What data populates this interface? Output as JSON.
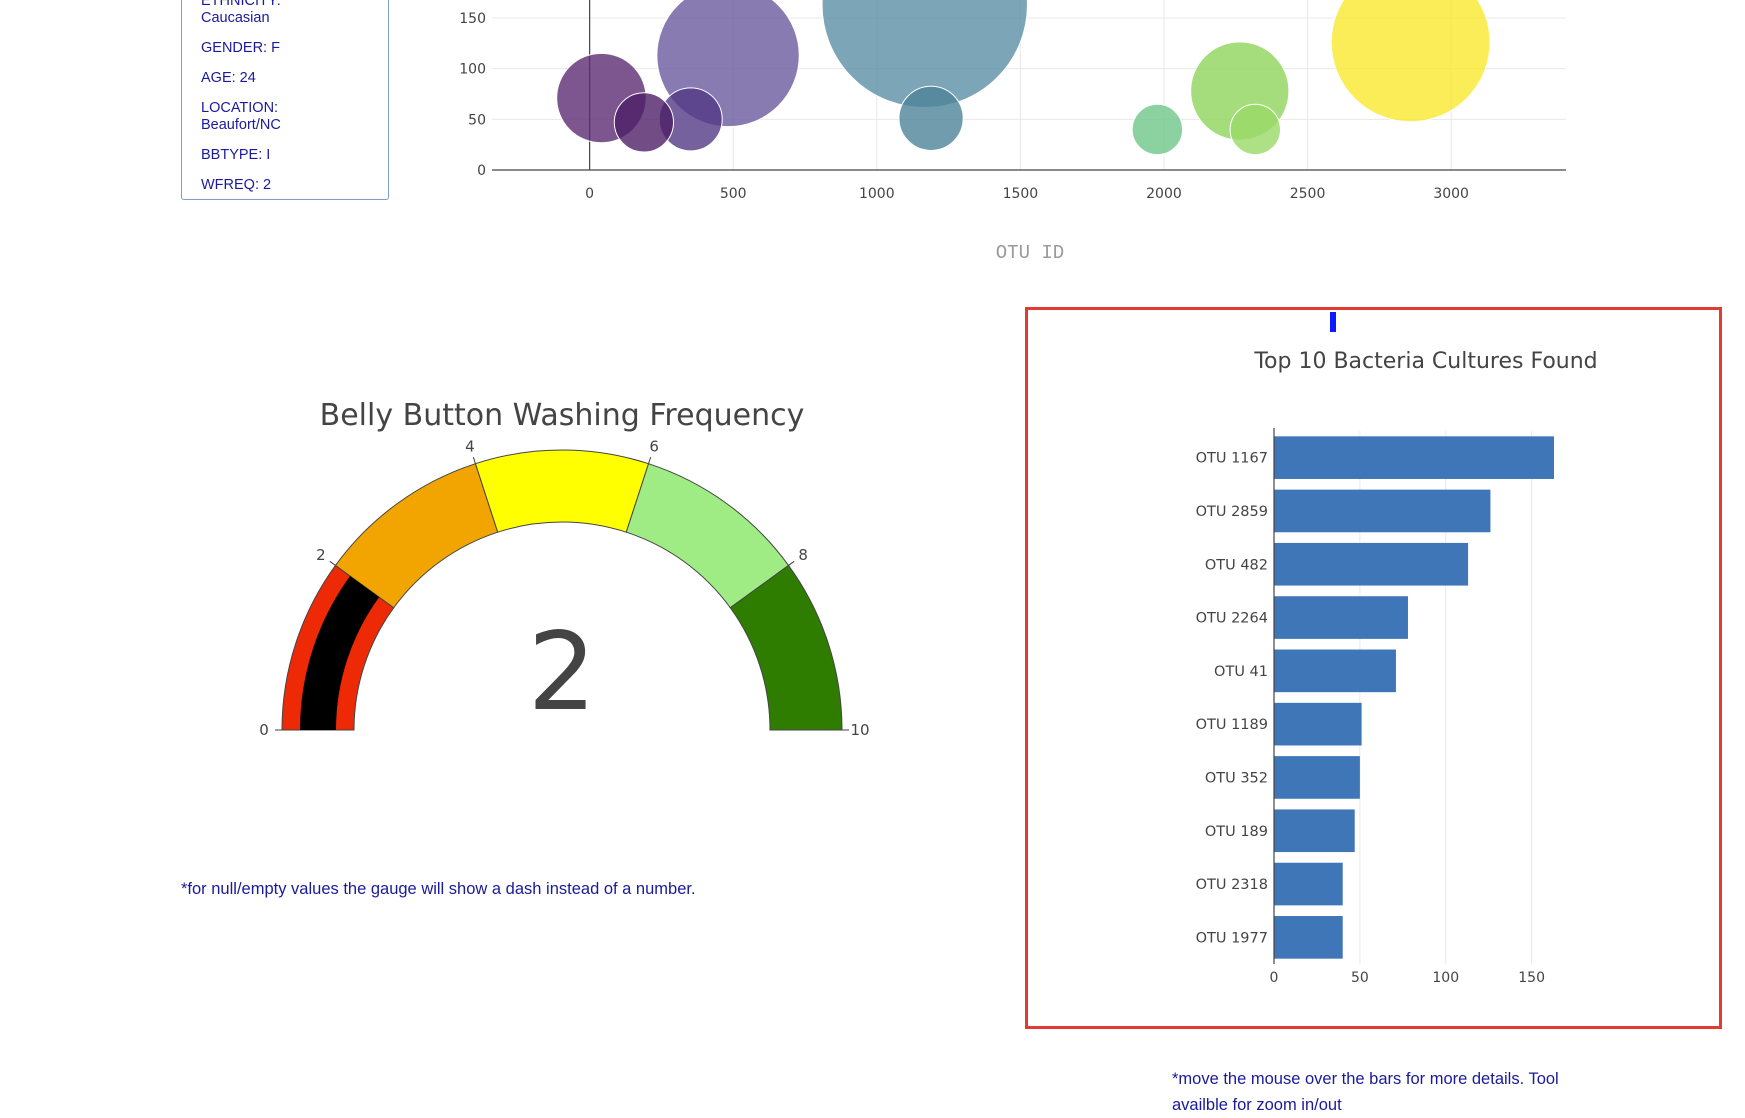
{
  "metadata": {
    "rows": [
      "ETHNICITY: Caucasian",
      "GENDER: F",
      "AGE: 24",
      "LOCATION: Beaufort/NC",
      "BBTYPE: I",
      "WFREQ: 2"
    ]
  },
  "bubble_chart": {
    "xlabel": "OTU ID"
  },
  "gauge": {
    "title": "Belly Button Washing Frequency",
    "value_text": "2"
  },
  "bar_chart": {
    "title": "Top 10 Bacteria Cultures Found"
  },
  "notes": {
    "gauge_note": "*for null/empty values the gauge will show a dash instead of a number.",
    "bar_note_line1": "*move the mouse over the bars for more details. Tool",
    "bar_note_line2": "availble for zoom in/out"
  },
  "colors": {
    "text": "#1a1a9c",
    "bar": "#3f76b8",
    "needle_marker": "#0b1cff",
    "box_border": "#e03c32"
  },
  "chart_data": [
    {
      "type": "scatter",
      "xlabel": "OTU ID",
      "ylabel": "",
      "xlim": [
        -340,
        3400
      ],
      "ylim": [
        0,
        165
      ],
      "xticks": [
        0,
        500,
        1000,
        1500,
        2000,
        2500,
        3000
      ],
      "yticks": [
        0,
        50,
        100,
        150
      ],
      "grid": true,
      "bubbles": [
        {
          "otu": 1167,
          "x": 1167,
          "y": 163,
          "size": 163,
          "color": "#5b8fa5"
        },
        {
          "otu": 2859,
          "x": 2859,
          "y": 126,
          "size": 126,
          "color": "#f9e92d"
        },
        {
          "otu": 482,
          "x": 482,
          "y": 113,
          "size": 113,
          "color": "#6a5a9f"
        },
        {
          "otu": 2264,
          "x": 2264,
          "y": 78,
          "size": 78,
          "color": "#8fd45c"
        },
        {
          "otu": 41,
          "x": 41,
          "y": 71,
          "size": 71,
          "color": "#5c2a73"
        },
        {
          "otu": 1189,
          "x": 1189,
          "y": 51,
          "size": 51,
          "color": "#4d8399"
        },
        {
          "otu": 352,
          "x": 352,
          "y": 50,
          "size": 50,
          "color": "#533a85"
        },
        {
          "otu": 189,
          "x": 189,
          "y": 47,
          "size": 47,
          "color": "#4e1f66"
        },
        {
          "otu": 2318,
          "x": 2318,
          "y": 40,
          "size": 40,
          "color": "#9ad966"
        },
        {
          "otu": 1977,
          "x": 1977,
          "y": 40,
          "size": 40,
          "color": "#6fc789"
        }
      ]
    },
    {
      "type": "gauge",
      "title": "Belly Button Washing Frequency",
      "value": 2,
      "range": [
        0,
        10
      ],
      "ticks": [
        0,
        2,
        4,
        6,
        8,
        10
      ],
      "steps": [
        {
          "range": [
            0,
            2
          ],
          "color": "#ee2a06"
        },
        {
          "range": [
            2,
            4
          ],
          "color": "#f2a500"
        },
        {
          "range": [
            4,
            6
          ],
          "color": "#ffff00"
        },
        {
          "range": [
            6,
            8
          ],
          "color": "#a0ec84"
        },
        {
          "range": [
            8,
            10
          ],
          "color": "#2e7d00"
        }
      ],
      "bar_color": "#000000"
    },
    {
      "type": "bar",
      "orientation": "horizontal",
      "title": "Top 10 Bacteria Cultures Found",
      "categories": [
        "OTU 1167",
        "OTU 2859",
        "OTU 482",
        "OTU 2264",
        "OTU 41",
        "OTU 1189",
        "OTU 352",
        "OTU 189",
        "OTU 2318",
        "OTU 1977"
      ],
      "values": [
        163,
        126,
        113,
        78,
        71,
        51,
        50,
        47,
        40,
        40
      ],
      "xlim": [
        0,
        170
      ],
      "xticks": [
        0,
        50,
        100,
        150
      ],
      "grid": true
    }
  ]
}
